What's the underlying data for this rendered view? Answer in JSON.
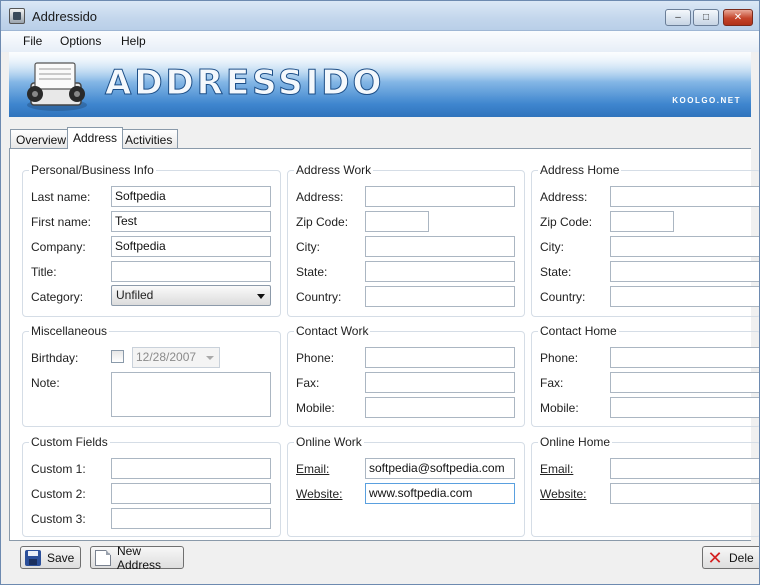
{
  "window": {
    "title": "Addressido"
  },
  "menu": [
    "File",
    "Options",
    "Help"
  ],
  "banner": {
    "title": "ADDRESSIDO",
    "subtitle": "KOOLGO.NET"
  },
  "tabs": [
    "Overview",
    "Address",
    "Activities"
  ],
  "active_tab": "Address",
  "personal": {
    "title": "Personal/Business Info",
    "last_name_label": "Last name:",
    "last_name": "Softpedia",
    "first_name_label": "First name:",
    "first_name": "Test",
    "company_label": "Company:",
    "company": "Softpedia",
    "title_label": "Title:",
    "title_value": "",
    "category_label": "Category:",
    "category": "Unfiled"
  },
  "address_work": {
    "title": "Address Work",
    "address_label": "Address:",
    "zip_label": "Zip Code:",
    "city_label": "City:",
    "state_label": "State:",
    "country_label": "Country:"
  },
  "address_home": {
    "title": "Address Home",
    "address_label": "Address:",
    "zip_label": "Zip Code:",
    "city_label": "City:",
    "state_label": "State:",
    "country_label": "Country:"
  },
  "misc": {
    "title": "Miscellaneous",
    "birthday_label": "Birthday:",
    "birthday": "12/28/2007",
    "birthday_checked": false,
    "note_label": "Note:"
  },
  "contact_work": {
    "title": "Contact Work",
    "phone_label": "Phone:",
    "fax_label": "Fax:",
    "mobile_label": "Mobile:"
  },
  "contact_home": {
    "title": "Contact Home",
    "phone_label": "Phone:",
    "fax_label": "Fax:",
    "mobile_label": "Mobile:"
  },
  "custom": {
    "title": "Custom Fields",
    "c1_label": "Custom 1:",
    "c2_label": "Custom 2:",
    "c3_label": "Custom 3:"
  },
  "online_work": {
    "title": "Online Work",
    "email_label": "Email:",
    "email": "softpedia@softpedia.com",
    "website_label": "Website:",
    "website": "www.softpedia.com"
  },
  "online_home": {
    "title": "Online Home",
    "email_label": "Email:",
    "website_label": "Website:"
  },
  "buttons": {
    "save": "Save",
    "new_address": "New Address",
    "delete": "Dele"
  },
  "icons": [
    "app-icon",
    "rolodex-icon",
    "save-icon",
    "new-address-icon",
    "delete-icon",
    "dropdown-arrow-icon"
  ]
}
